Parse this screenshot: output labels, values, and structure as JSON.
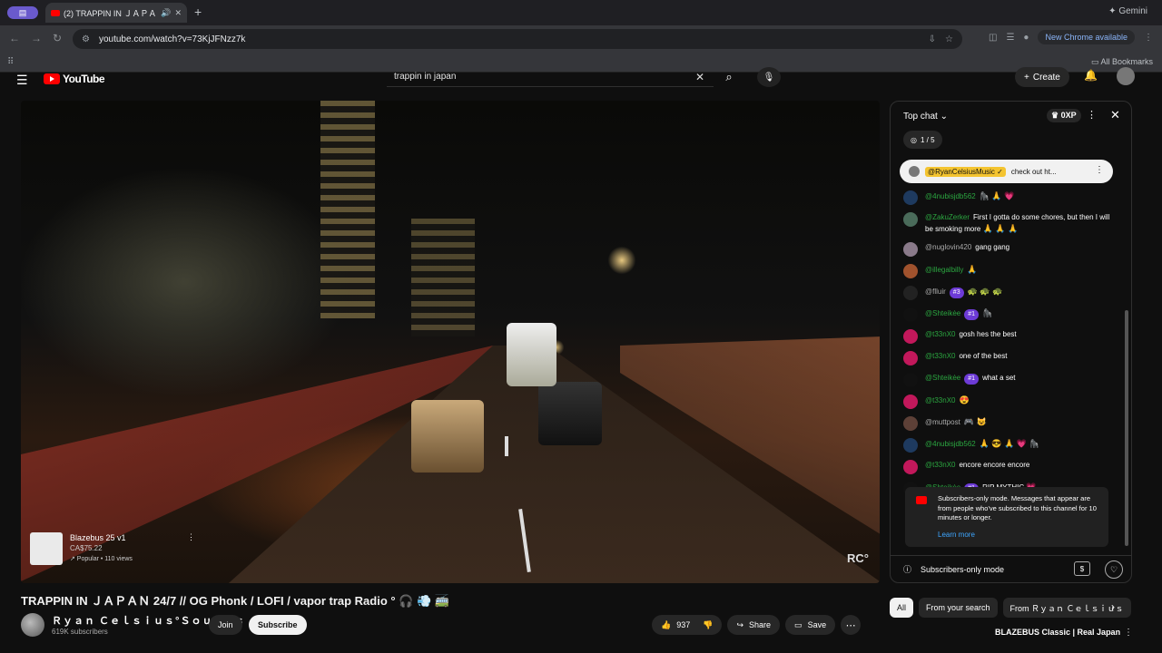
{
  "browser": {
    "tab_title": "(2) TRAPPIN IN ＪＡＰＡＮ",
    "gemini_label": "Gemini",
    "url": "youtube.com/watch?v=73KjJFNzz7k",
    "new_chrome_label": "New Chrome available",
    "all_bookmarks_label": "All Bookmarks"
  },
  "youtube": {
    "logo_text": "YouTube",
    "search_query": "trappin in japan",
    "create_label": "Create"
  },
  "video": {
    "watermark": "RC°",
    "product": {
      "name": "Blazebus 25 v1",
      "price": "CA$75.22",
      "meta": "↗ Popular • 110 views"
    },
    "title": "TRAPPIN IN ＪＡＰＡＮ 24/7 // OG Phonk / LOFI / vapor trap Radio °",
    "title_emoji": "🎧 💨 🚎"
  },
  "channel": {
    "name": "Ｒｙａｎ Ｃｅｌｓｉｕｓ°Ｓｏｕｎｄｓ",
    "subscribers": "619K subscribers",
    "join_label": "Join",
    "subscribe_label": "Subscribe"
  },
  "actions": {
    "like_count": "937",
    "share_label": "Share",
    "save_label": "Save"
  },
  "chat": {
    "header_label": "Top chat",
    "xp_label": "0XP",
    "goal_progress": "1 / 5",
    "pinned_author": "@RyanCelsiusMusic ✓",
    "pinned_text": "check out ht...",
    "messages": [
      {
        "author": "@4nubisjdb562",
        "member": true,
        "badge": "",
        "text": "",
        "emoji": "🦍 🙏 💗",
        "avatar_color": "#1e3a5f"
      },
      {
        "author": "@ZakuZerker",
        "member": true,
        "badge": "",
        "text": "First I gotta do some chores, but then I will be smoking more",
        "emoji": "🙏 🙏 🙏",
        "avatar_color": "#4a6b5a"
      },
      {
        "author": "@nuglovin420",
        "member": false,
        "badge": "",
        "text": "gang gang",
        "emoji": "",
        "avatar_color": "#8a7a8a"
      },
      {
        "author": "@illegalbilly",
        "member": true,
        "badge": "",
        "text": "",
        "emoji": "🙏",
        "avatar_color": "#a0522d"
      },
      {
        "author": "@flluir",
        "member": false,
        "badge": "#3",
        "text": "",
        "emoji": "🐢 🐢 🐢",
        "avatar_color": "#222222"
      },
      {
        "author": "@Shteikėe",
        "member": true,
        "badge": "#1",
        "text": "",
        "emoji": "🦍",
        "avatar_color": "#111111"
      },
      {
        "author": "@t33nX0",
        "member": true,
        "badge": "",
        "text": "gosh hes the best",
        "emoji": "",
        "avatar_color": "#c2185b"
      },
      {
        "author": "@t33nX0",
        "member": true,
        "badge": "",
        "text": "one of the best",
        "emoji": "",
        "avatar_color": "#c2185b"
      },
      {
        "author": "@Shteikėe",
        "member": true,
        "badge": "#1",
        "text": "what a set",
        "emoji": "",
        "avatar_color": "#111111"
      },
      {
        "author": "@t33nX0",
        "member": true,
        "badge": "",
        "text": "",
        "emoji": "😍",
        "avatar_color": "#c2185b"
      },
      {
        "author": "@muttpost",
        "member": false,
        "badge": "",
        "text": "",
        "emoji": "🎮 😺",
        "avatar_color": "#5d4037"
      },
      {
        "author": "@4nubisjdb562",
        "member": true,
        "badge": "",
        "text": "",
        "emoji": "🙏 😎 🙏 💗 🦍",
        "avatar_color": "#1e3a5f"
      },
      {
        "author": "@t33nX0",
        "member": true,
        "badge": "",
        "text": "encore encore encore",
        "emoji": "",
        "avatar_color": "#c2185b"
      },
      {
        "author": "@Shteikėe",
        "member": true,
        "badge": "#1",
        "text": "RIP MYTHIC",
        "emoji": "💗",
        "avatar_color": "#111111"
      }
    ],
    "notice_text": "Subscribers-only mode. Messages that appear are from people who've subscribed to this channel for 10 minutes or longer.",
    "learn_more": "Learn more",
    "footer_label": "Subscribers-only mode"
  },
  "chips": [
    "All",
    "From your search",
    "From Ｒｙａｎ Ｃｅｌｓｉｕｓ"
  ],
  "recommended_title": "BLAZEBUS Classic | Real Japan",
  "icons": {
    "accent": "#ff0000",
    "link": "#3ea6ff",
    "member_name": "#2ba640"
  }
}
